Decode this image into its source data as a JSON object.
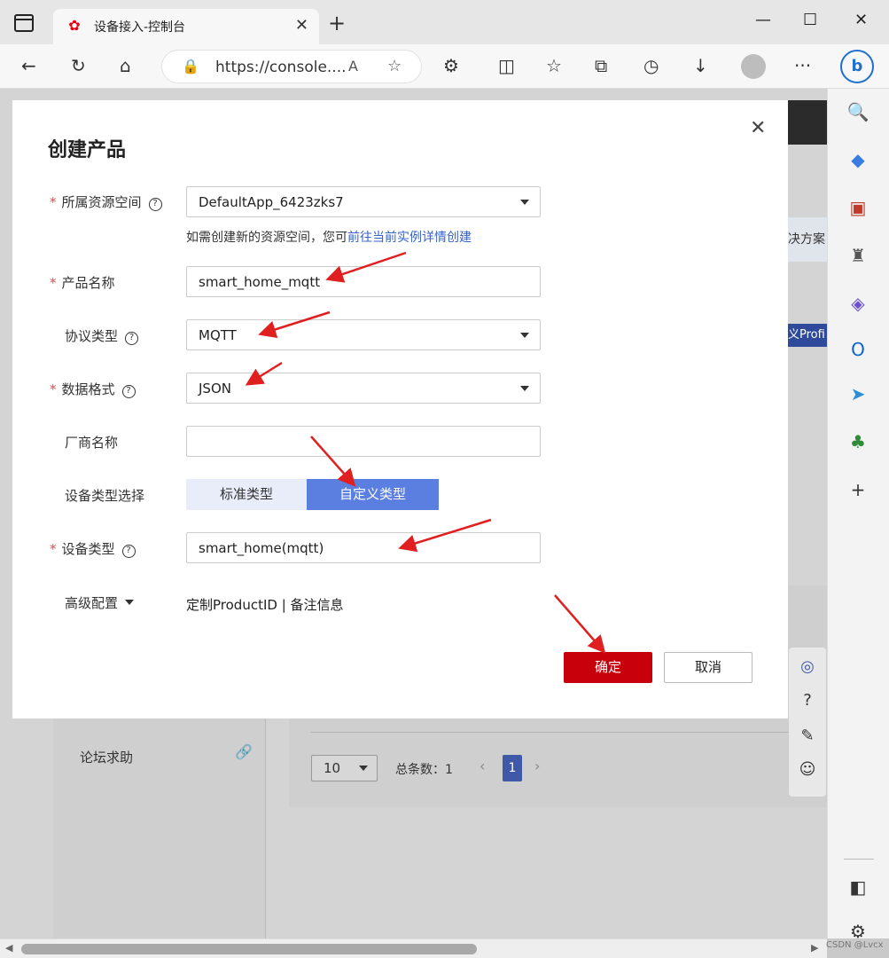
{
  "browser": {
    "tab_title": "设备接入-控制台",
    "url": "https://console....",
    "new_tab": "+",
    "tab_close": "✕"
  },
  "page": {
    "forum_label": "论坛求助",
    "pager": {
      "page_size": "10",
      "total_label": "总条数：1",
      "current_page": "1"
    },
    "right_fragments": [
      "决方案",
      "义Profi"
    ]
  },
  "modal": {
    "title": "创建产品",
    "close": "✕",
    "fields": {
      "resource_space": {
        "label": "所属资源空间",
        "value": "DefaultApp_6423zks7",
        "required": true
      },
      "hint_prefix": "如需创建新的资源空间，您可",
      "hint_link": "前往当前实例详情创建",
      "product_name": {
        "label": "产品名称",
        "value": "smart_home_mqtt",
        "required": true
      },
      "protocol": {
        "label": "协议类型",
        "value": "MQTT"
      },
      "data_format": {
        "label": "数据格式",
        "value": "JSON",
        "required": true
      },
      "vendor": {
        "label": "厂商名称",
        "value": ""
      },
      "device_type_select": {
        "label": "设备类型选择",
        "options": [
          "标准类型",
          "自定义类型"
        ],
        "selected": "自定义类型"
      },
      "device_type": {
        "label": "设备类型",
        "value": "smart_home(mqtt)",
        "required": true
      },
      "advanced": {
        "label": "高级配置",
        "value": "定制ProductID | 备注信息"
      }
    },
    "buttons": {
      "ok": "确定",
      "cancel": "取消"
    }
  },
  "watermark": "CSDN @Lvcx",
  "colors": {
    "primary_red": "#c7000b",
    "segment_selected": "#5b7fe0",
    "link": "#3763c8",
    "annotation_arrow": "#e02020"
  }
}
